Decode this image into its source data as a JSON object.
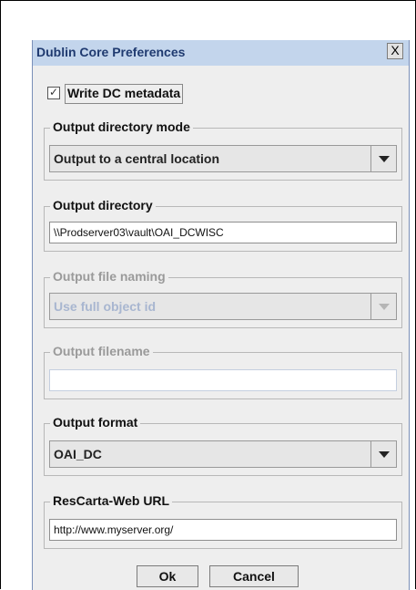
{
  "dialog": {
    "title": "Dublin Core Preferences",
    "close_label": "X"
  },
  "write_dc": {
    "label": "Write DC metadata",
    "checked": true,
    "check_glyph": "✓"
  },
  "output_directory_mode": {
    "legend": "Output directory mode",
    "selected": "Output to a central location"
  },
  "output_directory": {
    "legend": "Output directory",
    "value": "\\\\Prodserver03\\vault\\OAI_DCWISC"
  },
  "output_file_naming": {
    "legend": "Output file naming",
    "selected": "Use full object id",
    "enabled": false
  },
  "output_filename": {
    "legend": "Output filename",
    "value": "",
    "enabled": false
  },
  "output_format": {
    "legend": "Output format",
    "selected": "OAI_DC"
  },
  "rescarta_url": {
    "legend": "ResCarta-Web URL",
    "value": "http://www.myserver.org/"
  },
  "buttons": {
    "ok": "Ok",
    "cancel": "Cancel"
  }
}
